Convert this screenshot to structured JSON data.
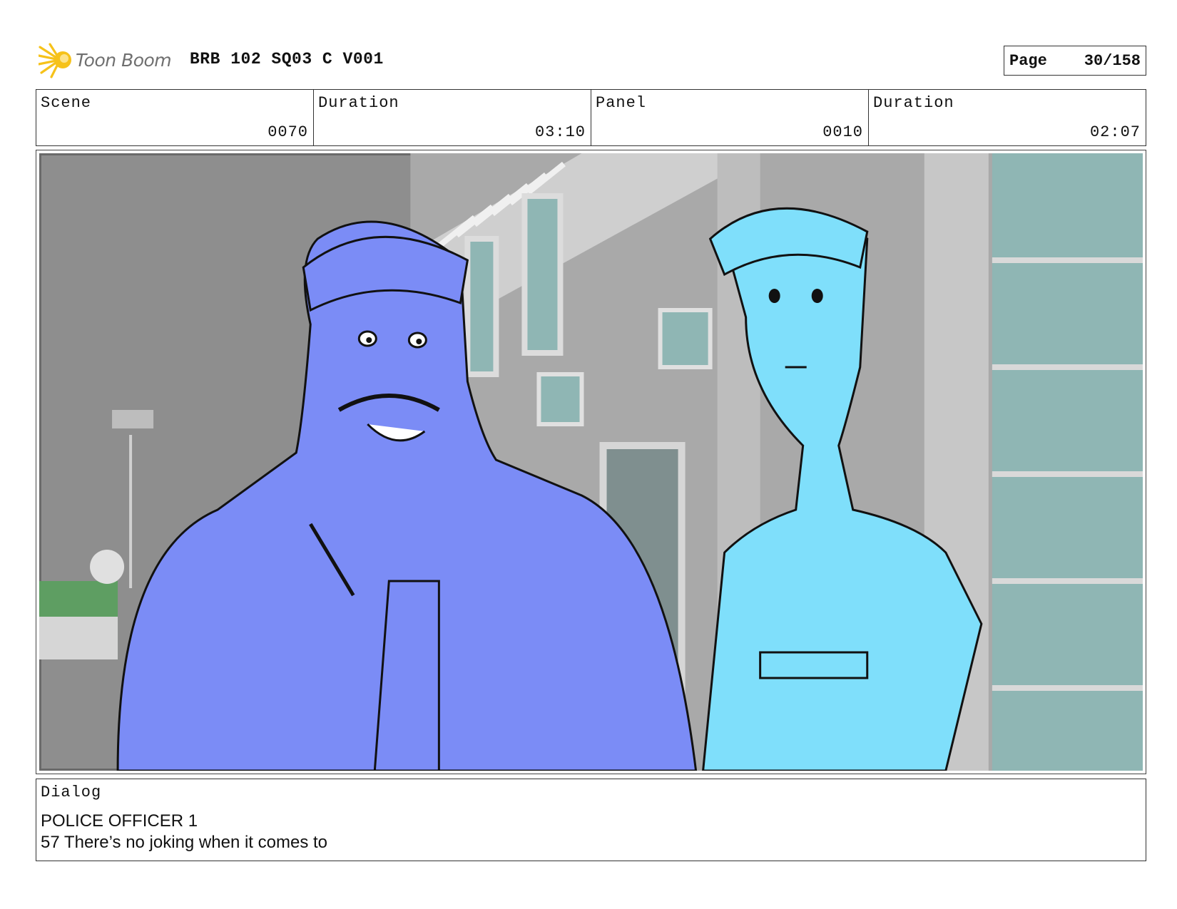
{
  "header": {
    "logo_text": "Toon Boom",
    "title": "BRB 102 SQ03 C V001",
    "page_label": "Page",
    "page_number": "30/158"
  },
  "info": {
    "scene_label": "Scene",
    "scene_value": "0070",
    "scene_duration_label": "Duration",
    "scene_duration_value": "03:10",
    "panel_label": "Panel",
    "panel_value": "0010",
    "panel_duration_label": "Duration",
    "panel_duration_value": "02:07"
  },
  "dialog": {
    "label": "Dialog",
    "speaker": "POLICE OFFICER 1",
    "line": "57 There’s no joking when it comes to"
  },
  "colors": {
    "officer1_fill": "#7b8cf6",
    "officer2_fill": "#7fdffb",
    "logo_yellow": "#f6c21a",
    "background_gray": "#8e8e8e",
    "window_teal": "#8fb6b4",
    "grass_green": "#5e9e62"
  },
  "icons": {
    "logo": "toon-boom-star-icon"
  }
}
